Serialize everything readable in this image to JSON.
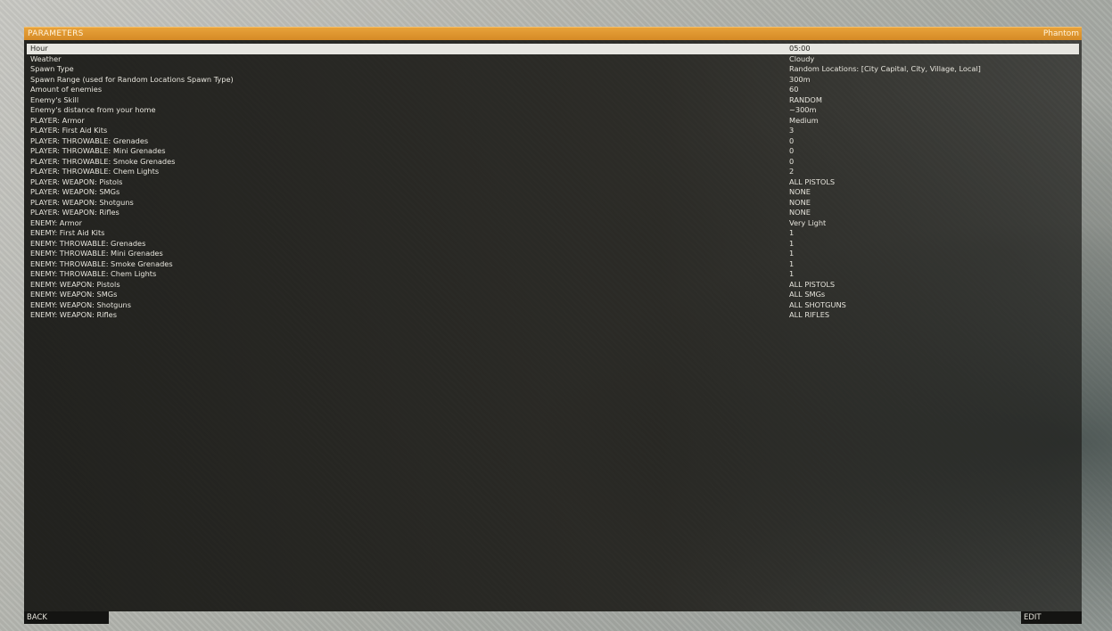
{
  "header": {
    "title": "PARAMETERS",
    "profile": "Phantom"
  },
  "parameters": [
    {
      "name": "Hour",
      "value": "05:00",
      "selected": true
    },
    {
      "name": "Weather",
      "value": "Cloudy"
    },
    {
      "name": "Spawn Type",
      "value": "Random Locations: [City Capital, City, Village, Local]"
    },
    {
      "name": "Spawn Range (used for Random Locations Spawn Type)",
      "value": "300m"
    },
    {
      "name": "Amount of enemies",
      "value": "60"
    },
    {
      "name": "Enemy's Skill",
      "value": "RANDOM"
    },
    {
      "name": "Enemy's distance from your home",
      "value": "~300m"
    },
    {
      "name": "PLAYER: Armor",
      "value": "Medium"
    },
    {
      "name": "PLAYER: First Aid Kits",
      "value": "3"
    },
    {
      "name": "PLAYER: THROWABLE: Grenades",
      "value": "0"
    },
    {
      "name": "PLAYER: THROWABLE: Mini Grenades",
      "value": "0"
    },
    {
      "name": "PLAYER: THROWABLE: Smoke Grenades",
      "value": "0"
    },
    {
      "name": "PLAYER: THROWABLE: Chem Lights",
      "value": "2"
    },
    {
      "name": "PLAYER: WEAPON: Pistols",
      "value": "ALL PISTOLS"
    },
    {
      "name": "PLAYER: WEAPON: SMGs",
      "value": "NONE"
    },
    {
      "name": "PLAYER: WEAPON: Shotguns",
      "value": "NONE"
    },
    {
      "name": "PLAYER: WEAPON: Rifles",
      "value": "NONE"
    },
    {
      "name": "ENEMY: Armor",
      "value": "Very Light"
    },
    {
      "name": "ENEMY: First Aid Kits",
      "value": "1"
    },
    {
      "name": "ENEMY: THROWABLE: Grenades",
      "value": "1"
    },
    {
      "name": "ENEMY: THROWABLE: Mini Grenades",
      "value": "1"
    },
    {
      "name": "ENEMY: THROWABLE: Smoke Grenades",
      "value": "1"
    },
    {
      "name": "ENEMY: THROWABLE: Chem Lights",
      "value": "1"
    },
    {
      "name": "ENEMY: WEAPON: Pistols",
      "value": "ALL PISTOLS"
    },
    {
      "name": "ENEMY: WEAPON: SMGs",
      "value": "ALL SMGs"
    },
    {
      "name": "ENEMY: WEAPON: Shotguns",
      "value": "ALL SHOTGUNS"
    },
    {
      "name": "ENEMY: WEAPON: Rifles",
      "value": "ALL RIFLES"
    }
  ],
  "footer": {
    "back_label": "BACK",
    "edit_label": "EDIT"
  },
  "colors": {
    "accent": "#e09a33",
    "selected_row": "#e7e6e1",
    "text": "#e6e4dc"
  }
}
